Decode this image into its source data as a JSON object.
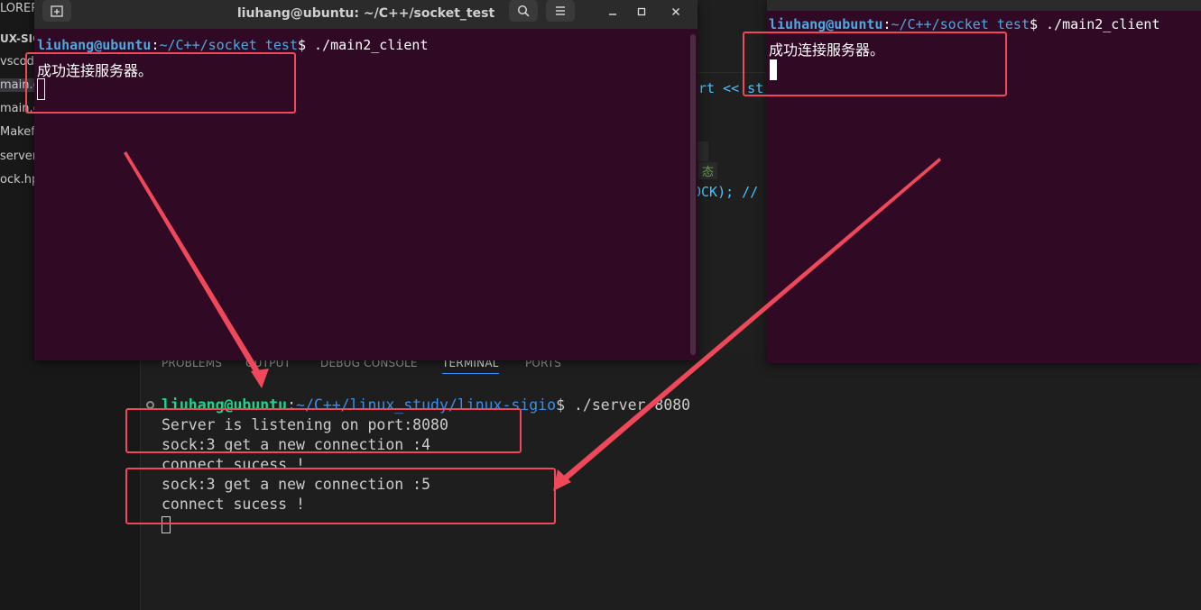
{
  "explorer": {
    "header": "LORER",
    "folder": "UX-SIGI",
    "items": [
      "vscode",
      "main.c",
      "main.o",
      "Makefi",
      "server",
      "ock.hp"
    ]
  },
  "editor_fragments": {
    "cout": "rt << st",
    "sock": "OCK); //",
    "comment": "态"
  },
  "panel": {
    "tabs": [
      "PROBLEMS",
      "OUTPUT",
      "DEBUG CONSOLE",
      "TERMINAL",
      "PORTS"
    ]
  },
  "vscode_terminal": {
    "prompt_user": "liuhang@ubuntu",
    "prompt_sep": ":",
    "prompt_path": "~/C++/linux_study/linux-sigio",
    "prompt_cmd": "$ ./server 8080",
    "lines": [
      "Server is listening on port:8080",
      "sock:3 get a new connection :4",
      "connect sucess !",
      "sock:3 get a new connection :5",
      "connect sucess !"
    ]
  },
  "terminal1": {
    "title": "liuhang@ubuntu: ~/C++/socket_test",
    "prompt_user": "liuhang@ubuntu",
    "prompt_sep": ":",
    "prompt_path": "~/C++/socket_test",
    "prompt_cmd": "$ ./main2_client",
    "output": "成功连接服务器。"
  },
  "terminal2": {
    "prompt_user": "liuhang@ubuntu",
    "prompt_sep": ":",
    "prompt_path": "~/C++/socket_test",
    "prompt_cmd": "$ ./main2_client",
    "output": "成功连接服务器。"
  },
  "icons": {
    "new_tab": "new-tab-icon",
    "search": "search-icon",
    "menu": "hamburger-menu-icon",
    "minimize": "minimize-icon",
    "maximize": "maximize-icon",
    "close": "close-icon"
  },
  "colors": {
    "terminal_bg": "#300a24",
    "prompt_blue": "#4ea8e0",
    "vscode_prompt_green": "#23d18b",
    "vscode_path_blue": "#3b8eea",
    "annotation_red": "#f0485b"
  }
}
